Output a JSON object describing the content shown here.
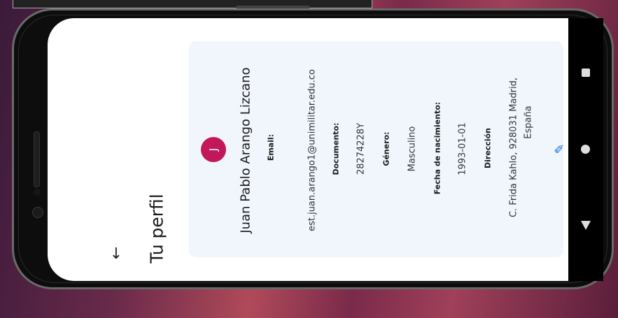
{
  "app": {
    "page_title": "Tu perfil"
  },
  "profile": {
    "avatar_initial": "J",
    "name": "Juan Pablo Arango Lizcano",
    "email_label": "Email:",
    "email": "est.juan.arango1@unimilitar.edu.co",
    "document_label": "Documento:",
    "document": "28274228Y",
    "gender_label": "Género:",
    "gender": "Masculino",
    "birth_label": "Fecha de nacimiento:",
    "birth": "1993-01-01",
    "address_label": "Dirección",
    "address_line1": "C. Frida Kahlo, 928031 Madrid,",
    "address_line2": "España"
  },
  "icons": {
    "back": "arrow-back-icon",
    "edit": "pencil-icon"
  },
  "colors": {
    "avatar_bg": "#c2185b",
    "card_bg": "#f1f6fd",
    "edit_icon": "#1976d2"
  }
}
